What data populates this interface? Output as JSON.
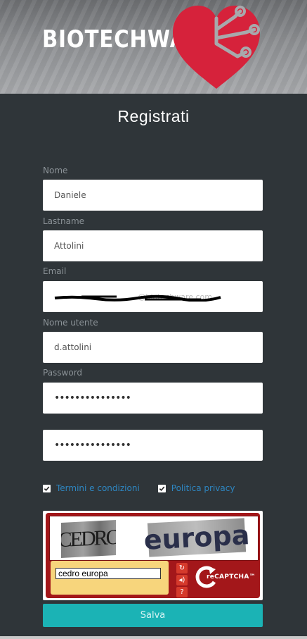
{
  "header": {
    "brand": "BIOTECHWARE"
  },
  "page_title": "Registrati",
  "form": {
    "nome_label": "Nome",
    "nome_value": "Daniele",
    "lastname_label": "Lastname",
    "lastname_value": "Attolini",
    "email_label": "Email",
    "email_value": "...@biotechware.com",
    "username_label": "Nome utente",
    "username_value": "d.attolini",
    "password_label": "Password",
    "password_value": "•••••••••••••••",
    "password_confirm_value": "•••••••••••••••"
  },
  "checkboxes": {
    "terms_label": "Termini e condizioni",
    "privacy_label": "Politica privacy"
  },
  "captcha": {
    "word1": "CEDRO",
    "word2": "europa",
    "input_value": "cedro europa",
    "logo_text": "reCAPTCHA™"
  },
  "submit_label": "Salva",
  "colors": {
    "background": "#2f3539",
    "accent_button": "#1bb3b5",
    "link": "#2e86c1",
    "heart": "#d6223b",
    "captcha_red": "#a3171a"
  }
}
